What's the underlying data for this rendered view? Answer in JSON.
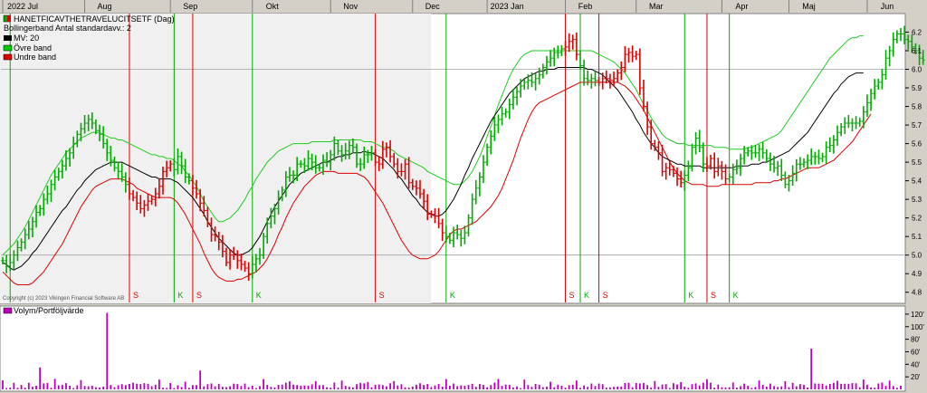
{
  "chart_data": {
    "type": "bar",
    "title": "HANETFICAVTHETRAVELUCITSETF (Dag)",
    "subtitle": "Bollingerband  Antal standardavv.: 2",
    "legend": [
      {
        "label": "HANETFICAVTHETRAVELUCITSETF (Dag)",
        "color": "#00aa00",
        "color2": "#dd0000"
      },
      {
        "label": "Bollingerband  Antal standardavv.: 2",
        "color": "",
        "color2": ""
      },
      {
        "label": "MV: 20",
        "color": "#000000",
        "color2": ""
      },
      {
        "label": "Övre band",
        "color": "#00cc00",
        "color2": ""
      },
      {
        "label": "Undre band",
        "color": "#dd0000",
        "color2": ""
      }
    ],
    "months": [
      {
        "label": "2022 Jul",
        "at": 0
      },
      {
        "label": "Aug",
        "at": 22
      },
      {
        "label": "Sep",
        "at": 45
      },
      {
        "label": "Okt",
        "at": 67
      },
      {
        "label": "Nov",
        "at": 88
      },
      {
        "label": "Dec",
        "at": 110
      },
      {
        "label": "2023 Jan",
        "at": 130
      },
      {
        "label": "Feb",
        "at": 151
      },
      {
        "label": "Mar",
        "at": 170
      },
      {
        "label": "Apr",
        "at": 193
      },
      {
        "label": "Maj",
        "at": 211
      },
      {
        "label": "Jun",
        "at": 232
      }
    ],
    "y_ticks": [
      "4.8",
      "4.9",
      "5.0",
      "5.1",
      "5.2",
      "5.3",
      "5.4",
      "5.5",
      "5.6",
      "5.7",
      "5.8",
      "5.9",
      "6.0",
      "6.1",
      "6.2"
    ],
    "ylim": [
      4.75,
      6.29
    ],
    "n_days": 242,
    "close": [
      4.97,
      4.94,
      4.96,
      5.0,
      5.04,
      5.07,
      5.11,
      5.14,
      5.18,
      5.23,
      5.25,
      5.3,
      5.33,
      5.38,
      5.42,
      5.45,
      5.48,
      5.52,
      5.55,
      5.6,
      5.65,
      5.68,
      5.71,
      5.73,
      5.71,
      5.67,
      5.65,
      5.6,
      5.55,
      5.51,
      5.47,
      5.45,
      5.42,
      5.38,
      5.33,
      5.31,
      5.28,
      5.25,
      5.27,
      5.29,
      5.3,
      5.33,
      5.37,
      5.45,
      5.47,
      5.49,
      5.46,
      5.53,
      5.48,
      5.42,
      5.4,
      5.36,
      5.33,
      5.28,
      5.24,
      5.17,
      5.11,
      5.1,
      5.07,
      5.02,
      4.96,
      5.0,
      5.0,
      4.97,
      4.95,
      4.93,
      4.9,
      4.95,
      4.98,
      5.0,
      5.1,
      5.17,
      5.21,
      5.25,
      5.31,
      5.35,
      5.42,
      5.43,
      5.43,
      5.49,
      5.49,
      5.48,
      5.52,
      5.5,
      5.47,
      5.47,
      5.51,
      5.5,
      5.54,
      5.6,
      5.56,
      5.54,
      5.56,
      5.59,
      5.58,
      5.49,
      5.49,
      5.54,
      5.54,
      5.55,
      5.5,
      5.49,
      5.57,
      5.58,
      5.53,
      5.49,
      5.45,
      5.45,
      5.49,
      5.39,
      5.37,
      5.36,
      5.33,
      5.29,
      5.22,
      5.22,
      5.21,
      5.17,
      5.12,
      5.1,
      5.08,
      5.12,
      5.11,
      5.09,
      5.12,
      5.2,
      5.3,
      5.36,
      5.42,
      5.5,
      5.58,
      5.64,
      5.7,
      5.73,
      5.76,
      5.77,
      5.81,
      5.85,
      5.88,
      5.91,
      5.93,
      5.94,
      5.93,
      5.95,
      5.97,
      6.01,
      6.04,
      6.06,
      6.09,
      6.09,
      6.11,
      6.12,
      6.15,
      6.16,
      6.08,
      6.02,
      5.95,
      5.94,
      5.95,
      5.94,
      5.93,
      5.95,
      5.95,
      5.94,
      5.95,
      5.98,
      6.01,
      6.08,
      6.09,
      6.07,
      6.08,
      5.9,
      5.8,
      5.69,
      5.6,
      5.58,
      5.55,
      5.45,
      5.47,
      5.46,
      5.44,
      5.41,
      5.39,
      5.43,
      5.47,
      5.58,
      5.63,
      5.58,
      5.49,
      5.48,
      5.52,
      5.45,
      5.48,
      5.45,
      5.41,
      5.42,
      5.46,
      5.47,
      5.52,
      5.55,
      5.56,
      5.55,
      5.55,
      5.57,
      5.55,
      5.52,
      5.49,
      5.47,
      5.48,
      5.43,
      5.38,
      5.4,
      5.44,
      5.49,
      5.49,
      5.5,
      5.51,
      5.53,
      5.53,
      5.52,
      5.53,
      5.58,
      5.59,
      5.62,
      5.66,
      5.69,
      5.71,
      5.71,
      5.71,
      5.71,
      5.72,
      5.77,
      5.82,
      5.87,
      5.91,
      5.93,
      5.97,
      6.06,
      6.1,
      6.16,
      6.19,
      6.19,
      6.16,
      6.15,
      6.12,
      6.1,
      6.06,
      6.05
    ],
    "mv": [
      4.96,
      4.95,
      4.93,
      4.92,
      4.93,
      4.94,
      4.96,
      4.98,
      5.01,
      5.03,
      5.06,
      5.09,
      5.12,
      5.15,
      5.18,
      5.21,
      5.24,
      5.26,
      5.29,
      5.32,
      5.35,
      5.37,
      5.4,
      5.42,
      5.44,
      5.46,
      5.47,
      5.48,
      5.49,
      5.5,
      5.5,
      5.5,
      5.5,
      5.49,
      5.48,
      5.47,
      5.46,
      5.45,
      5.44,
      5.43,
      5.42,
      5.42,
      5.41,
      5.41,
      5.41,
      5.41,
      5.4,
      5.39,
      5.37,
      5.35,
      5.33,
      5.31,
      5.28,
      5.25,
      5.22,
      5.18,
      5.15,
      5.12,
      5.09,
      5.07,
      5.05,
      5.03,
      5.01,
      5.0,
      5.0,
      5.01,
      5.02,
      5.04,
      5.07,
      5.1,
      5.14,
      5.18,
      5.22,
      5.26,
      5.29,
      5.32,
      5.35,
      5.38,
      5.4,
      5.42,
      5.44,
      5.45,
      5.46,
      5.47,
      5.48,
      5.49,
      5.5,
      5.5,
      5.51,
      5.52,
      5.53,
      5.53,
      5.54,
      5.54,
      5.55,
      5.55,
      5.55,
      5.56,
      5.55,
      5.55,
      5.54,
      5.53,
      5.52,
      5.5,
      5.48,
      5.46,
      5.43,
      5.41,
      5.38,
      5.35,
      5.32,
      5.3,
      5.27,
      5.25,
      5.23,
      5.22,
      5.21,
      5.21,
      5.22,
      5.24,
      5.27,
      5.3,
      5.34,
      5.38,
      5.43,
      5.47,
      5.52,
      5.56,
      5.6,
      5.64,
      5.68,
      5.72,
      5.75,
      5.78,
      5.81,
      5.84,
      5.87,
      5.89,
      5.91,
      5.93,
      5.95,
      5.96,
      5.97,
      5.98,
      5.99,
      5.99,
      6.0,
      6.0,
      6.0,
      6.01,
      6.01,
      6.01,
      6.01,
      6.01,
      6.01,
      6.01,
      6.01,
      6.0,
      6.0,
      5.99,
      5.98,
      5.97,
      5.95,
      5.93,
      5.91,
      5.89,
      5.86,
      5.83,
      5.8,
      5.77,
      5.73,
      5.7,
      5.66,
      5.63,
      5.6,
      5.58,
      5.55,
      5.53,
      5.52,
      5.51,
      5.5,
      5.49,
      5.49,
      5.48,
      5.48,
      5.48,
      5.48,
      5.48,
      5.47,
      5.47,
      5.47,
      5.47,
      5.47,
      5.47,
      5.47,
      5.47,
      5.47,
      5.48,
      5.48,
      5.48,
      5.48,
      5.49,
      5.49,
      5.49,
      5.5,
      5.5,
      5.51,
      5.52,
      5.53,
      5.54,
      5.55,
      5.56,
      5.58,
      5.6,
      5.62,
      5.64,
      5.66,
      5.69,
      5.72,
      5.75,
      5.78,
      5.81,
      5.84,
      5.87,
      5.89,
      5.92,
      5.94,
      5.96,
      5.97,
      5.98,
      5.98,
      5.98
    ],
    "upper": [
      5.0,
      5.02,
      5.04,
      5.06,
      5.09,
      5.12,
      5.15,
      5.19,
      5.23,
      5.27,
      5.31,
      5.35,
      5.39,
      5.43,
      5.46,
      5.49,
      5.52,
      5.55,
      5.57,
      5.59,
      5.61,
      5.63,
      5.64,
      5.65,
      5.66,
      5.66,
      5.66,
      5.65,
      5.64,
      5.63,
      5.63,
      5.62,
      5.62,
      5.61,
      5.6,
      5.59,
      5.58,
      5.57,
      5.56,
      5.55,
      5.54,
      5.54,
      5.53,
      5.53,
      5.52,
      5.52,
      5.51,
      5.49,
      5.48,
      5.45,
      5.43,
      5.4,
      5.37,
      5.33,
      5.29,
      5.26,
      5.23,
      5.2,
      5.18,
      5.18,
      5.19,
      5.2,
      5.22,
      5.24,
      5.27,
      5.3,
      5.34,
      5.37,
      5.41,
      5.44,
      5.47,
      5.5,
      5.52,
      5.54,
      5.56,
      5.57,
      5.58,
      5.59,
      5.6,
      5.6,
      5.6,
      5.6,
      5.6,
      5.61,
      5.61,
      5.61,
      5.61,
      5.61,
      5.61,
      5.62,
      5.62,
      5.62,
      5.62,
      5.62,
      5.62,
      5.62,
      5.62,
      5.61,
      5.61,
      5.61,
      5.6,
      5.59,
      5.58,
      5.58,
      5.57,
      5.56,
      5.54,
      5.53,
      5.52,
      5.51,
      5.5,
      5.49,
      5.48,
      5.47,
      5.45,
      5.44,
      5.43,
      5.42,
      5.41,
      5.4,
      5.39,
      5.38,
      5.38,
      5.38,
      5.4,
      5.42,
      5.45,
      5.49,
      5.53,
      5.58,
      5.64,
      5.69,
      5.75,
      5.81,
      5.86,
      5.91,
      5.96,
      6.0,
      6.03,
      6.06,
      6.08,
      6.09,
      6.1,
      6.1,
      6.1,
      6.1,
      6.1,
      6.1,
      6.1,
      6.1,
      6.1,
      6.1,
      6.1,
      6.1,
      6.1,
      6.1,
      6.1,
      6.1,
      6.1,
      6.09,
      6.08,
      6.07,
      6.06,
      6.05,
      6.04,
      6.02,
      6.0,
      5.98,
      5.95,
      5.92,
      5.89,
      5.85,
      5.81,
      5.78,
      5.74,
      5.71,
      5.68,
      5.65,
      5.63,
      5.62,
      5.61,
      5.6,
      5.6,
      5.6,
      5.59,
      5.59,
      5.59,
      5.59,
      5.59,
      5.59,
      5.59,
      5.58,
      5.58,
      5.58,
      5.58,
      5.57,
      5.57,
      5.57,
      5.57,
      5.57,
      5.58,
      5.58,
      5.59,
      5.6,
      5.61,
      5.62,
      5.63,
      5.64,
      5.65,
      5.67,
      5.7,
      5.73,
      5.76,
      5.79,
      5.82,
      5.85,
      5.88,
      5.91,
      5.94,
      5.97,
      6.0,
      6.03,
      6.06,
      6.08,
      6.1,
      6.12,
      6.14,
      6.16,
      6.17,
      6.17,
      6.18,
      6.18
    ],
    "lower": [
      4.91,
      4.89,
      4.87,
      4.85,
      4.84,
      4.84,
      4.84,
      4.84,
      4.85,
      4.87,
      4.89,
      4.91,
      4.94,
      4.97,
      5.0,
      5.03,
      5.06,
      5.1,
      5.14,
      5.18,
      5.22,
      5.26,
      5.29,
      5.32,
      5.35,
      5.37,
      5.38,
      5.39,
      5.4,
      5.41,
      5.41,
      5.41,
      5.41,
      5.4,
      5.39,
      5.38,
      5.36,
      5.35,
      5.34,
      5.33,
      5.32,
      5.31,
      5.31,
      5.31,
      5.31,
      5.31,
      5.3,
      5.28,
      5.25,
      5.22,
      5.18,
      5.14,
      5.1,
      5.06,
      5.01,
      4.97,
      4.93,
      4.9,
      4.88,
      4.87,
      4.86,
      4.86,
      4.86,
      4.87,
      4.87,
      4.88,
      4.89,
      4.9,
      4.91,
      4.93,
      4.95,
      4.98,
      5.02,
      5.06,
      5.11,
      5.15,
      5.2,
      5.24,
      5.28,
      5.31,
      5.34,
      5.37,
      5.39,
      5.41,
      5.43,
      5.44,
      5.45,
      5.45,
      5.45,
      5.45,
      5.44,
      5.44,
      5.44,
      5.44,
      5.44,
      5.44,
      5.43,
      5.42,
      5.4,
      5.37,
      5.34,
      5.31,
      5.28,
      5.24,
      5.2,
      5.16,
      5.12,
      5.08,
      5.05,
      5.02,
      5.0,
      4.99,
      4.98,
      4.98,
      4.98,
      4.99,
      5.0,
      5.02,
      5.05,
      5.08,
      5.11,
      5.13,
      5.14,
      5.14,
      5.15,
      5.16,
      5.17,
      5.18,
      5.2,
      5.22,
      5.24,
      5.26,
      5.29,
      5.32,
      5.36,
      5.41,
      5.46,
      5.51,
      5.57,
      5.63,
      5.68,
      5.73,
      5.77,
      5.8,
      5.82,
      5.83,
      5.84,
      5.85,
      5.86,
      5.87,
      5.88,
      5.89,
      5.9,
      5.91,
      5.92,
      5.93,
      5.93,
      5.93,
      5.93,
      5.93,
      5.93,
      5.93,
      5.93,
      5.93,
      5.93,
      5.93,
      5.92,
      5.91,
      5.89,
      5.87,
      5.84,
      5.81,
      5.78,
      5.74,
      5.7,
      5.66,
      5.62,
      5.58,
      5.54,
      5.5,
      5.47,
      5.44,
      5.42,
      5.4,
      5.39,
      5.38,
      5.38,
      5.38,
      5.38,
      5.37,
      5.37,
      5.37,
      5.37,
      5.38,
      5.38,
      5.38,
      5.38,
      5.38,
      5.38,
      5.38,
      5.38,
      5.38,
      5.39,
      5.39,
      5.39,
      5.39,
      5.39,
      5.4,
      5.4,
      5.41,
      5.41,
      5.42,
      5.43,
      5.44,
      5.45,
      5.46,
      5.47,
      5.47,
      5.47,
      5.47,
      5.48,
      5.49,
      5.5,
      5.51,
      5.53,
      5.55,
      5.57,
      5.59,
      5.61,
      5.64,
      5.67,
      5.7,
      5.73,
      5.76
    ],
    "signals": [
      {
        "day": 2,
        "type": "K",
        "label": "",
        "color": "#00aa00"
      },
      {
        "day": 34,
        "type": "S",
        "label": "S",
        "color": "#dd0000"
      },
      {
        "day": 46,
        "type": "K",
        "label": "K",
        "color": "#00aa00"
      },
      {
        "day": 51,
        "type": "S",
        "label": "S",
        "color": "#dd0000"
      },
      {
        "day": 67,
        "type": "K",
        "label": "K",
        "color": "#00aa00"
      },
      {
        "day": 100,
        "type": "S",
        "label": "S",
        "color": "#dd0000"
      },
      {
        "day": 119,
        "type": "K",
        "label": "K",
        "color": "#00aa00"
      },
      {
        "day": 151,
        "type": "S",
        "label": "S",
        "color": "#dd0000"
      },
      {
        "day": 155,
        "type": "K",
        "label": "K",
        "color": "#00aa00"
      },
      {
        "day": 160,
        "type": "S",
        "label": "S",
        "color": "#dd0000"
      },
      {
        "day": 183,
        "type": "K",
        "label": "K",
        "color": "#00aa00"
      },
      {
        "day": 189,
        "type": "S",
        "label": "S",
        "color": "#dd0000"
      },
      {
        "day": 195,
        "type": "K",
        "label": "K",
        "color": "#00aa00"
      }
    ],
    "shaded_until_day": 115,
    "copyright": "Copyright (c) 2023 Vikingen Financial Software AB",
    "volume": {
      "label": "Volym/Portföljvärde",
      "color": "#bb00bb",
      "ticks": [
        "20'",
        "40'",
        "60'",
        "80'",
        "100'",
        "120'"
      ],
      "ylim": [
        0,
        130
      ],
      "spikes": [
        [
          10,
          35
        ],
        [
          28,
          122
        ],
        [
          53,
          30
        ],
        [
          217,
          65
        ]
      ],
      "seed_base": 9
    }
  }
}
